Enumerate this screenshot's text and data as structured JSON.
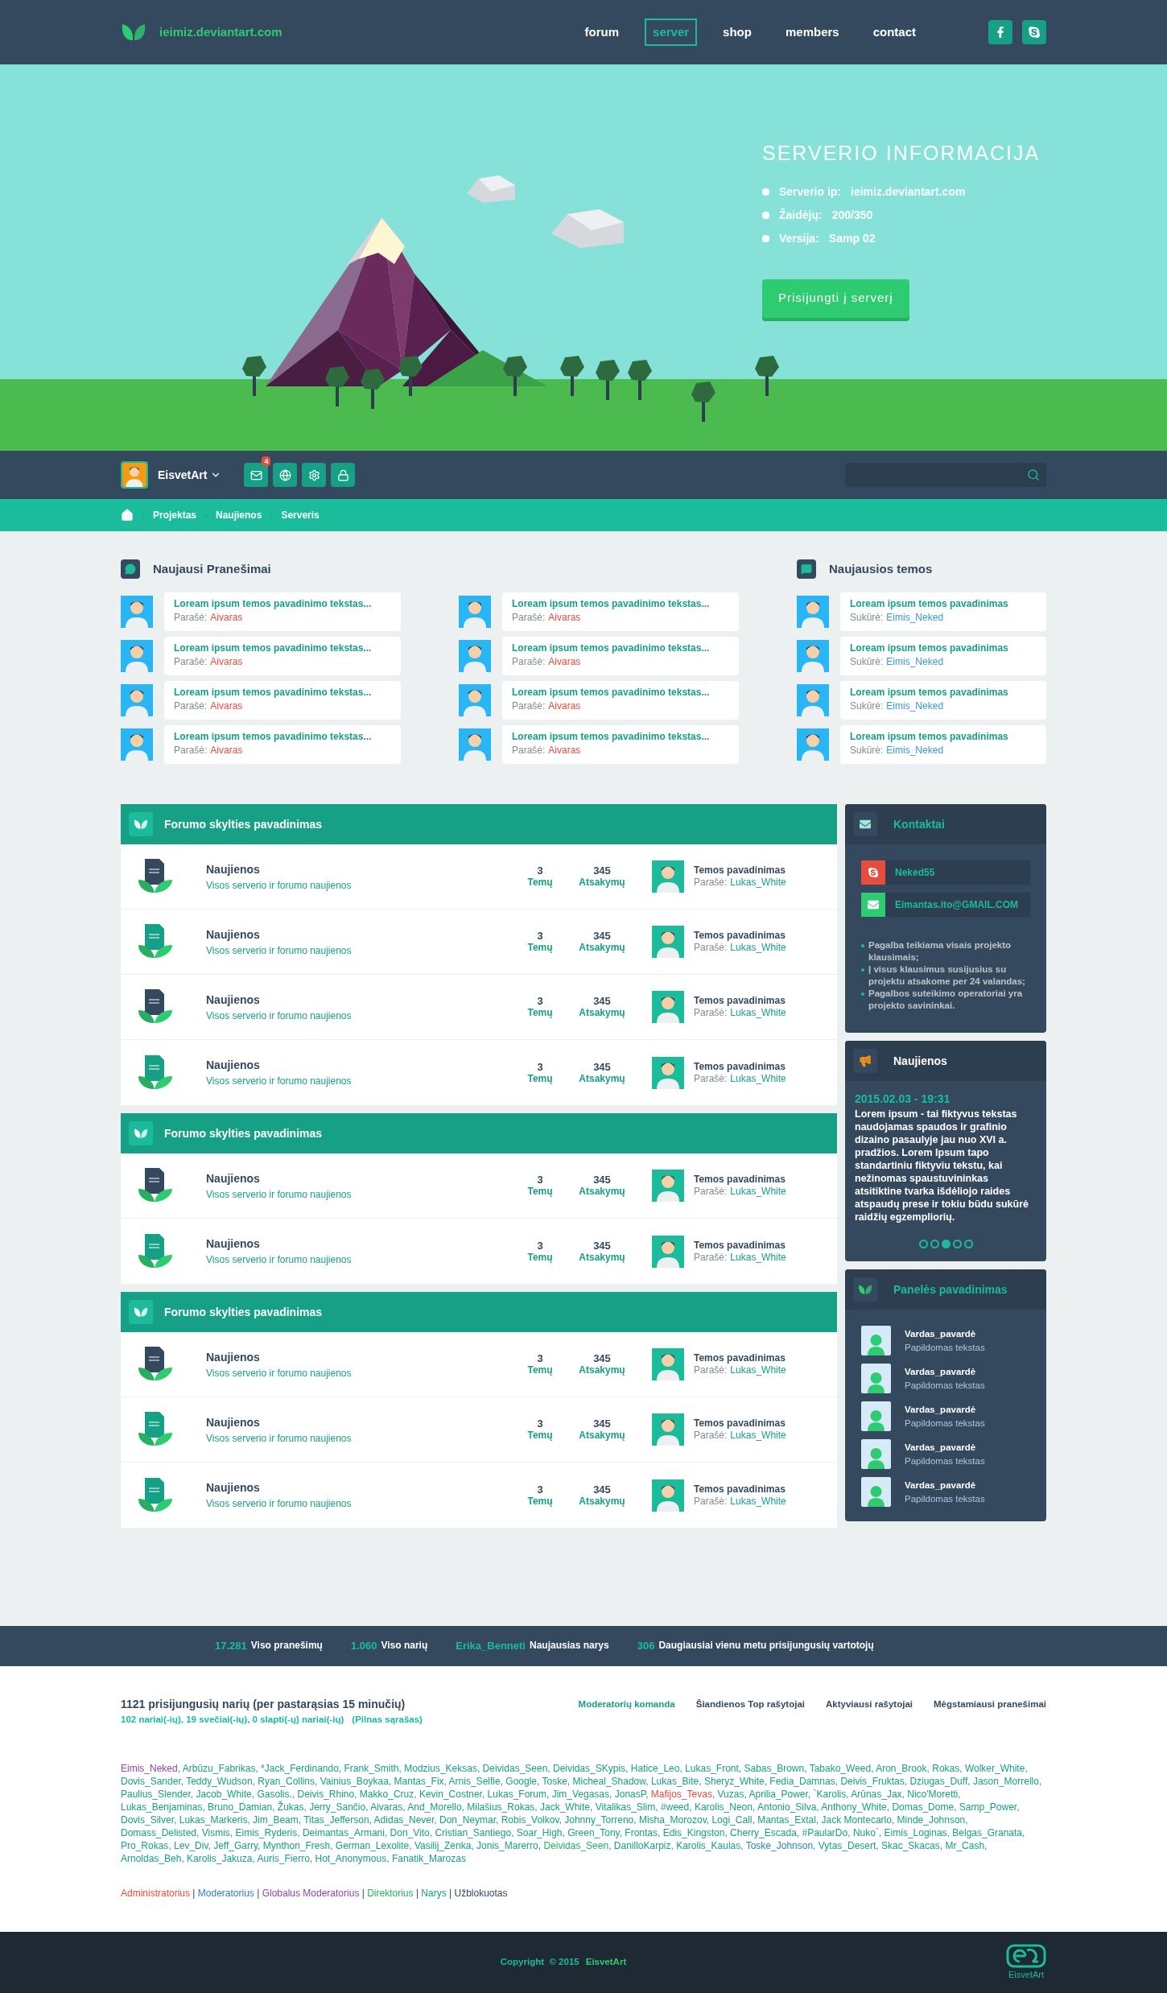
{
  "header": {
    "site_name": "ieimiz.deviantart.com",
    "nav": [
      {
        "label": "forum",
        "selected": false
      },
      {
        "label": "server",
        "selected": true
      },
      {
        "label": "shop",
        "selected": false
      },
      {
        "label": "members",
        "selected": false
      },
      {
        "label": "contact",
        "selected": false
      }
    ]
  },
  "hero": {
    "title": "SERVERIO INFORMACIJA",
    "info": [
      {
        "label": "Serverio ip:",
        "value": "ieimiz.deviantart.com"
      },
      {
        "label": "Žaidėjų:",
        "value": "200/350"
      },
      {
        "label": "Versija:",
        "value": "Samp 02"
      }
    ],
    "button": "Prisijungti į serverį"
  },
  "user_bar": {
    "username": "EisvetArt",
    "mail_badge": "4"
  },
  "breadcrumb": [
    "Projektas",
    "Naujienos",
    "Serveris"
  ],
  "latest_posts": {
    "title": "Naujausi Pranešimai",
    "items": [
      {
        "title": "Loream ipsum temos pavadinimo tekstas...",
        "by_label": "Parašė:",
        "author": "Aivaras"
      },
      {
        "title": "Loream ipsum temos pavadinimo tekstas...",
        "by_label": "Parašė:",
        "author": "Aivaras"
      },
      {
        "title": "Loream ipsum temos pavadinimo tekstas...",
        "by_label": "Parašė:",
        "author": "Aivaras"
      },
      {
        "title": "Loream ipsum temos pavadinimo tekstas...",
        "by_label": "Parašė:",
        "author": "Aivaras"
      },
      {
        "title": "Loream ipsum temos pavadinimo tekstas...",
        "by_label": "Parašė:",
        "author": "Aivaras"
      },
      {
        "title": "Loream ipsum temos pavadinimo tekstas...",
        "by_label": "Parašė:",
        "author": "Aivaras"
      },
      {
        "title": "Loream ipsum temos pavadinimo tekstas...",
        "by_label": "Parašė:",
        "author": "Aivaras"
      },
      {
        "title": "Loream ipsum temos pavadinimo tekstas...",
        "by_label": "Parašė:",
        "author": "Aivaras"
      }
    ]
  },
  "latest_topics": {
    "title": "Naujausios temos",
    "items": [
      {
        "title": "Loream ipsum temos pavadinimas",
        "by_label": "Sukūrė:",
        "author": "Eimis_Neked"
      },
      {
        "title": "Loream ipsum temos pavadinimas",
        "by_label": "Sukūrė:",
        "author": "Eimis_Neked"
      },
      {
        "title": "Loream ipsum temos pavadinimas",
        "by_label": "Sukūrė:",
        "author": "Eimis_Neked"
      },
      {
        "title": "Loream ipsum temos pavadinimas",
        "by_label": "Sukūrė:",
        "author": "Eimis_Neked"
      }
    ]
  },
  "forum_sections": [
    {
      "title": "Forumo skylties pavadinimas",
      "rows": [
        {
          "color": "#34495e",
          "name": "Naujienos",
          "description": "Visos serverio ir forumo naujienos",
          "topics": "3",
          "topics_label": "Temų",
          "replies": "345",
          "replies_label": "Atsakymų",
          "last_title": "Temos pavadinimas",
          "last_by_label": "Parašė:",
          "last_by": "Lukas_White"
        },
        {
          "color": "#16a085",
          "name": "Naujienos",
          "description": "Visos serverio ir forumo naujienos",
          "topics": "3",
          "topics_label": "Temų",
          "replies": "345",
          "replies_label": "Atsakymų",
          "last_title": "Temos pavadinimas",
          "last_by_label": "Parašė:",
          "last_by": "Lukas_White"
        },
        {
          "color": "#34495e",
          "name": "Naujienos",
          "description": "Visos serverio ir forumo naujienos",
          "topics": "3",
          "topics_label": "Temų",
          "replies": "345",
          "replies_label": "Atsakymų",
          "last_title": "Temos pavadinimas",
          "last_by_label": "Parašė:",
          "last_by": "Lukas_White"
        },
        {
          "color": "#16a085",
          "name": "Naujienos",
          "description": "Visos serverio ir forumo naujienos",
          "topics": "3",
          "topics_label": "Temų",
          "replies": "345",
          "replies_label": "Atsakymų",
          "last_title": "Temos pavadinimas",
          "last_by_label": "Parašė:",
          "last_by": "Lukas_White"
        }
      ]
    },
    {
      "title": "Forumo skylties pavadinimas",
      "rows": [
        {
          "color": "#34495e",
          "name": "Naujienos",
          "description": "Visos serverio ir forumo naujienos",
          "topics": "3",
          "topics_label": "Temų",
          "replies": "345",
          "replies_label": "Atsakymų",
          "last_title": "Temos pavadinimas",
          "last_by_label": "Parašė:",
          "last_by": "Lukas_White"
        },
        {
          "color": "#16a085",
          "name": "Naujienos",
          "description": "Visos serverio ir forumo naujienos",
          "topics": "3",
          "topics_label": "Temų",
          "replies": "345",
          "replies_label": "Atsakymų",
          "last_title": "Temos pavadinimas",
          "last_by_label": "Parašė:",
          "last_by": "Lukas_White"
        }
      ]
    },
    {
      "title": "Forumo skylties pavadinimas",
      "rows": [
        {
          "color": "#34495e",
          "name": "Naujienos",
          "description": "Visos serverio ir forumo naujienos",
          "topics": "3",
          "topics_label": "Temų",
          "replies": "345",
          "replies_label": "Atsakymų",
          "last_title": "Temos pavadinimas",
          "last_by_label": "Parašė:",
          "last_by": "Lukas_White"
        },
        {
          "color": "#16a085",
          "name": "Naujienos",
          "description": "Visos serverio ir forumo naujienos",
          "topics": "3",
          "topics_label": "Temų",
          "replies": "345",
          "replies_label": "Atsakymų",
          "last_title": "Temos pavadinimas",
          "last_by_label": "Parašė:",
          "last_by": "Lukas_White"
        },
        {
          "color": "#16a085",
          "name": "Naujienos",
          "description": "Visos serverio ir forumo naujienos",
          "topics": "3",
          "topics_label": "Temų",
          "replies": "345",
          "replies_label": "Atsakymų",
          "last_title": "Temos pavadinimas",
          "last_by_label": "Parašė:",
          "last_by": "Lukas_White"
        }
      ]
    }
  ],
  "contacts": {
    "title": "Kontaktai",
    "items": [
      {
        "kind": "skype",
        "value": "Neked55"
      },
      {
        "kind": "email",
        "value": "Eimantas.ito@GMAIL.COM"
      }
    ],
    "notes": [
      "Pagalba teikiama visais projekto klausimais;",
      "Į visus klausimus susijusius su projektu atsakome per 24 valandas;",
      "Pagalbos suteikimo operatoriai yra projekto savininkai."
    ]
  },
  "news": {
    "title": "Naujienos",
    "date": "2015.02.03 - 19:31",
    "text": "Lorem ipsum - tai fiktyvus tekstas naudojamas spaudos ir grafinio dizaino pasaulyje jau nuo XVI a. pradžios. Lorem Ipsum tapo standartiniu fiktyviu tekstu, kai nežinomas spaustuvininkas atsitiktine tvarka išdėliojo raides atspaudų prese ir tokiu būdu sukūrė raidžių egzempliorių.",
    "pages": [
      {
        "selected": false
      },
      {
        "selected": false
      },
      {
        "selected": true
      },
      {
        "selected": false
      },
      {
        "selected": false
      }
    ]
  },
  "panel": {
    "title": "Panelės pavadinimas",
    "users": [
      {
        "name": "Vardas_pavardė",
        "subtitle": "Papildomas tekstas"
      },
      {
        "name": "Vardas_pavardė",
        "subtitle": "Papildomas tekstas"
      },
      {
        "name": "Vardas_pavardė",
        "subtitle": "Papildomas tekstas"
      },
      {
        "name": "Vardas_pavardė",
        "subtitle": "Papildomas tekstas"
      },
      {
        "name": "Vardas_pavardė",
        "subtitle": "Papildomas tekstas"
      }
    ]
  },
  "stats": [
    {
      "value": "17.281",
      "label": "Viso pranešimų"
    },
    {
      "value": "1.060",
      "label": "Viso narių"
    },
    {
      "value": "Erika_Benneti",
      "label": "Naujausias narys"
    },
    {
      "value": "306",
      "label": "Daugiausiai vienu metu prisijungusių vartotojų"
    }
  ],
  "online": {
    "title": "1121 prisijungusių narių (per pastarąsias 15 minučių)",
    "summary": "102 nariai(-ių), 19 svečiai(-ių), 0 slapti(-ų) nariai(-ių)",
    "full_list": "(Pilnas sąrašas)",
    "tabs": [
      {
        "label": "Moderatorių komanda",
        "selected": true
      },
      {
        "label": "Šiandienos Top rašytojai",
        "selected": false
      },
      {
        "label": "Aktyviausi rašytojai",
        "selected": false
      },
      {
        "label": "Mėgstamiausi pranešimai",
        "selected": false
      }
    ],
    "separator": ", ",
    "users": [
      {
        "name": "Eimis_Neked",
        "color": "#8e44ad"
      },
      {
        "name": "Arbūzu_Fabrikas",
        "color": "#16a085"
      },
      {
        "name": "*Jack_Ferdinando",
        "color": "#16a085"
      },
      {
        "name": "Frank_Smith",
        "color": "#16a085"
      },
      {
        "name": "Modzius_Keksas",
        "color": "#16a085"
      },
      {
        "name": "Deividas_Seen",
        "color": "#16a085"
      },
      {
        "name": "Deividas_SKypis",
        "color": "#16a085"
      },
      {
        "name": "Hatice_Leo",
        "color": "#16a085"
      },
      {
        "name": "Lukas_Front",
        "color": "#16a085"
      },
      {
        "name": "Sabas_Brown",
        "color": "#16a085"
      },
      {
        "name": "Tabako_Weed",
        "color": "#16a085"
      },
      {
        "name": "Aron_Brook",
        "color": "#16a085"
      },
      {
        "name": "Rokas",
        "color": "#16a085"
      },
      {
        "name": "Wolker_White",
        "color": "#16a085"
      },
      {
        "name": "Dovis_Sander",
        "color": "#16a085"
      },
      {
        "name": "Teddy_Wudson",
        "color": "#16a085"
      },
      {
        "name": "Ryan_Collins",
        "color": "#16a085"
      },
      {
        "name": "Vainius_Boykaa",
        "color": "#16a085"
      },
      {
        "name": "Mantas_Fix",
        "color": "#16a085"
      },
      {
        "name": "Arnis_Selfie",
        "color": "#16a085"
      },
      {
        "name": "Google",
        "color": "#16a085"
      },
      {
        "name": "Toske",
        "color": "#16a085"
      },
      {
        "name": "Micheal_Shadow",
        "color": "#16a085"
      },
      {
        "name": "Lukas_Bite",
        "color": "#16a085"
      },
      {
        "name": "Sheryz_White",
        "color": "#16a085"
      },
      {
        "name": "Fedia_Damnas",
        "color": "#16a085"
      },
      {
        "name": "Deivis_Fruktas",
        "color": "#16a085"
      },
      {
        "name": "Dziugas_Duff",
        "color": "#16a085"
      },
      {
        "name": "Jason_Morrello",
        "color": "#16a085"
      },
      {
        "name": "Paulius_Slender",
        "color": "#16a085"
      },
      {
        "name": "Jacob_White",
        "color": "#16a085"
      },
      {
        "name": "Gasolis.",
        "color": "#16a085"
      },
      {
        "name": "Deivis_Rhino",
        "color": "#16a085"
      },
      {
        "name": "Makko_Cruz",
        "color": "#16a085"
      },
      {
        "name": "Kevin_Costner",
        "color": "#16a085"
      },
      {
        "name": "Lukas_Forum",
        "color": "#16a085"
      },
      {
        "name": "Jim_Vegasas",
        "color": "#16a085"
      },
      {
        "name": "JonasP",
        "color": "#16a085"
      },
      {
        "name": "Mafijos_Tevas",
        "color": "#e74c3c"
      },
      {
        "name": "Vuzas",
        "color": "#16a085"
      },
      {
        "name": "Aprilia_Power",
        "color": "#16a085"
      },
      {
        "name": "`Karolis",
        "color": "#16a085"
      },
      {
        "name": "Arūnas_Jax",
        "color": "#16a085"
      },
      {
        "name": "Nico'Moretti",
        "color": "#16a085"
      },
      {
        "name": "Lukas_Benjaminas",
        "color": "#16a085"
      },
      {
        "name": "Bruno_Damian",
        "color": "#16a085"
      },
      {
        "name": "Žukas",
        "color": "#16a085"
      },
      {
        "name": "Jerry_Sančio",
        "color": "#16a085"
      },
      {
        "name": "Aivaras",
        "color": "#16a085"
      },
      {
        "name": "And_Morello",
        "color": "#16a085"
      },
      {
        "name": "Milašius_Rokas",
        "color": "#16a085"
      },
      {
        "name": "Jack_White",
        "color": "#16a085"
      },
      {
        "name": "Vitalikas_Slim",
        "color": "#16a085"
      },
      {
        "name": "#weed",
        "color": "#16a085"
      },
      {
        "name": "Karolis_Neon",
        "color": "#16a085"
      },
      {
        "name": "Antonio_Silva",
        "color": "#16a085"
      },
      {
        "name": "Anthony_White",
        "color": "#16a085"
      },
      {
        "name": "Domas_Dome",
        "color": "#16a085"
      },
      {
        "name": "Samp_Power",
        "color": "#16a085"
      },
      {
        "name": "Dovis_Silver",
        "color": "#16a085"
      },
      {
        "name": "Lukas_Markeris",
        "color": "#16a085"
      },
      {
        "name": "Jim_Beam",
        "color": "#16a085"
      },
      {
        "name": "Titas_Jefferson",
        "color": "#16a085"
      },
      {
        "name": "Adidas_Never",
        "color": "#16a085"
      },
      {
        "name": "Don_Neymar",
        "color": "#16a085"
      },
      {
        "name": "Robis_Volkov",
        "color": "#16a085"
      },
      {
        "name": "Johnny_Torreno",
        "color": "#16a085"
      },
      {
        "name": "Misha_Morozov",
        "color": "#16a085"
      },
      {
        "name": "Logi_Call",
        "color": "#16a085"
      },
      {
        "name": "Mantas_Extal",
        "color": "#16a085"
      },
      {
        "name": "Jack Montecarlo",
        "color": "#16a085"
      },
      {
        "name": "Minde_Johnson",
        "color": "#16a085"
      },
      {
        "name": "Domass_Delisted",
        "color": "#16a085"
      },
      {
        "name": "Vismis",
        "color": "#16a085"
      },
      {
        "name": "Eimis_Ryderis",
        "color": "#16a085"
      },
      {
        "name": "Deimantas_Armani",
        "color": "#16a085"
      },
      {
        "name": "Don_Vito",
        "color": "#16a085"
      },
      {
        "name": "Cristian_Santiego",
        "color": "#16a085"
      },
      {
        "name": "Soar_High",
        "color": "#16a085"
      },
      {
        "name": "Green_Tony",
        "color": "#16a085"
      },
      {
        "name": "Frontas",
        "color": "#16a085"
      },
      {
        "name": "Edis_Kingston",
        "color": "#16a085"
      },
      {
        "name": "Cherry_Escada",
        "color": "#16a085"
      },
      {
        "name": "#PaularDo",
        "color": "#16a085"
      },
      {
        "name": "Nuko`",
        "color": "#16a085"
      },
      {
        "name": "Eimis_Loginas",
        "color": "#16a085"
      },
      {
        "name": "Belgas_Granata",
        "color": "#16a085"
      },
      {
        "name": "Pro_Rokas",
        "color": "#16a085"
      },
      {
        "name": "Lev_Div",
        "color": "#16a085"
      },
      {
        "name": "Jeff_Garry",
        "color": "#16a085"
      },
      {
        "name": "Mynthon_Fresh",
        "color": "#16a085"
      },
      {
        "name": "German_Lexolite",
        "color": "#16a085"
      },
      {
        "name": "Vasilij_Zenka",
        "color": "#16a085"
      },
      {
        "name": "Jonis_Marerro",
        "color": "#16a085"
      },
      {
        "name": "Deividas_Seen",
        "color": "#27ae60"
      },
      {
        "name": "DanilloKarpiz",
        "color": "#16a085"
      },
      {
        "name": "Karolis_Kaulas",
        "color": "#16a085"
      },
      {
        "name": "Toske_Johnson",
        "color": "#2980b9"
      },
      {
        "name": "Vytas_Desert",
        "color": "#16a085"
      },
      {
        "name": "Skac_Skacas",
        "color": "#16a085"
      },
      {
        "name": "Mr_Cash",
        "color": "#16a085"
      },
      {
        "name": "Arnoldas_Beh",
        "color": "#16a085"
      },
      {
        "name": "Karolis_Jakuza",
        "color": "#16a085"
      },
      {
        "name": "Auris_Fierro",
        "color": "#16a085"
      },
      {
        "name": "Hot_Anonymous",
        "color": "#16a085"
      },
      {
        "name": "Fanatik_Marozas",
        "color": "#16a085"
      }
    ],
    "legend_separator": " | ",
    "legend": [
      {
        "label": "Administratorius",
        "color": "#e74c3c"
      },
      {
        "label": "Moderatorius",
        "color": "#2980b9"
      },
      {
        "label": "Globalus Moderatorius",
        "color": "#8e44ad"
      },
      {
        "label": "Direktorius",
        "color": "#27ae60"
      },
      {
        "label": "Narys",
        "color": "#16a085"
      },
      {
        "label": "Užblokuotas",
        "color": "#34495e"
      }
    ]
  },
  "footer": {
    "copyright": "Copyright  © 2015",
    "brand": "EisvetArt",
    "logo_label": "EisvetArt"
  }
}
